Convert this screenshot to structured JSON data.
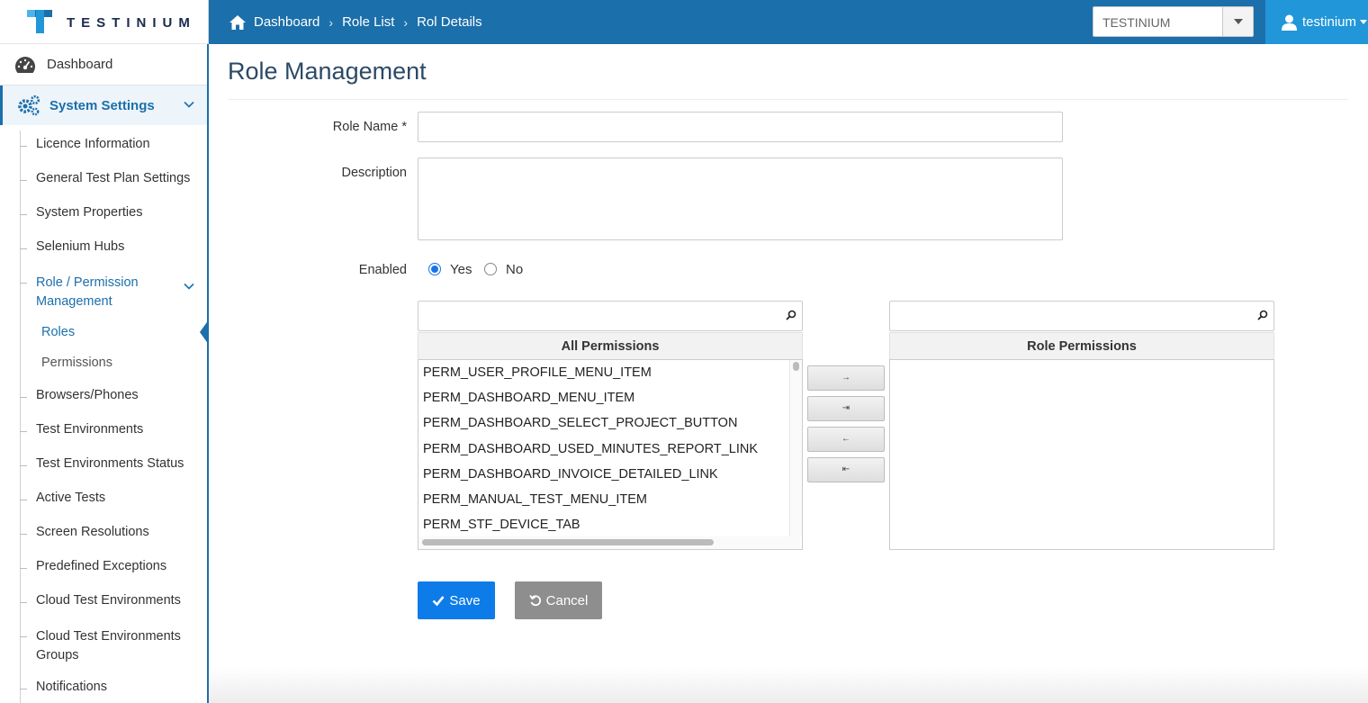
{
  "brand": {
    "name": "TESTINIUM"
  },
  "breadcrumb": [
    "Dashboard",
    "Role List",
    "Rol Details"
  ],
  "project_select": {
    "value": "TESTINIUM"
  },
  "user": {
    "name": "testinium"
  },
  "sidebar": {
    "dashboard": "Dashboard",
    "system_settings": "System Settings",
    "items": [
      "Licence Information",
      "General Test Plan Settings",
      "System Properties",
      "Selenium Hubs",
      "Role / Permission",
      "Browsers/Phones",
      "Test Environments",
      "Test Environments Status",
      "Active Tests",
      "Screen Resolutions",
      "Predefined Exceptions",
      "Cloud Test Environments",
      "Cloud Test Environments",
      "Notifications"
    ],
    "role_perm_line2": "Management",
    "cloud_groups_line2": "Groups",
    "sub_items": [
      "Roles",
      "Permissions"
    ]
  },
  "form": {
    "title": "Role Management",
    "role_name_label": "Role Name *",
    "role_name_value": "",
    "description_label": "Description",
    "description_value": "",
    "enabled_label": "Enabled",
    "enabled_yes": "Yes",
    "enabled_no": "No",
    "enabled_value": "Yes"
  },
  "permissions": {
    "all_header": "All Permissions",
    "role_header": "Role Permissions",
    "all_filter": "",
    "role_filter": "",
    "all_items": [
      "PERM_USER_PROFILE_MENU_ITEM",
      "PERM_DASHBOARD_MENU_ITEM",
      "PERM_DASHBOARD_SELECT_PROJECT_BUTTON",
      "PERM_DASHBOARD_USED_MINUTES_REPORT_LINK",
      "PERM_DASHBOARD_INVOICE_DETAILED_LINK",
      "PERM_MANUAL_TEST_MENU_ITEM",
      "PERM_STF_DEVICE_TAB"
    ],
    "role_items": [],
    "move_buttons": [
      "→",
      "⇥",
      "←",
      "⇤"
    ]
  },
  "actions": {
    "save": "Save",
    "cancel": "Cancel"
  },
  "colors": {
    "primary": "#1b6fab",
    "accent": "#2196d9",
    "save": "#0d7ce8",
    "cancel": "#8e8e8e"
  }
}
